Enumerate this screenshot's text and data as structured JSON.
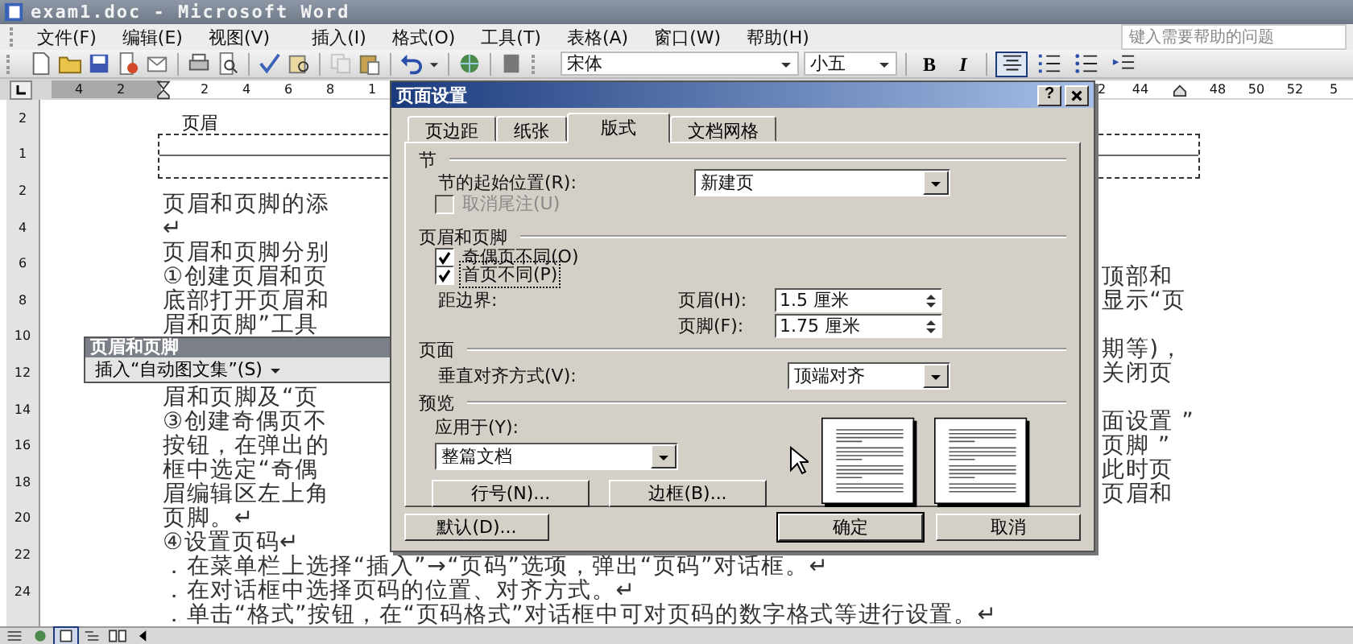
{
  "window": {
    "title": "exam1.doc - Microsoft Word"
  },
  "menu": [
    "文件(F)",
    "编辑(E)",
    "视图(V)",
    "插入(I)",
    "格式(O)",
    "工具(T)",
    "表格(A)",
    "窗口(W)",
    "帮助(H)"
  ],
  "help_box": {
    "placeholder": "键入需要帮助的问题"
  },
  "toolbar": {
    "font": "宋体",
    "size": "小五",
    "format_buttons": [
      {
        "label": "B",
        "kind": "bold",
        "selected": false
      },
      {
        "label": "I",
        "kind": "italic",
        "selected": false
      }
    ],
    "paragraph_buttons": [
      {
        "kind": "center",
        "selected": true
      },
      {
        "kind": "numbered",
        "selected": false
      },
      {
        "kind": "bullets",
        "selected": false
      },
      {
        "kind": "indent",
        "selected": false
      }
    ]
  },
  "ruler": {
    "left_labels": [
      "4",
      "2",
      "2",
      "4",
      "6",
      "8",
      "1"
    ],
    "right_labels": [
      "2",
      "44",
      "48",
      "50",
      "52",
      "5"
    ]
  },
  "vertical_ruler": {
    "labels": [
      "2",
      "1",
      "2",
      "4",
      "6",
      "8",
      "10",
      "12",
      "14",
      "16",
      "18",
      "20",
      "22",
      "24"
    ]
  },
  "document": {
    "header_label": "页眉",
    "lines": [
      {
        "left": "页眉和页脚的添"
      },
      {
        "left": "↵"
      },
      {
        "left": "页眉和页脚分别"
      },
      {
        "left": "①创建页眉和页",
        "right": "顶部和"
      },
      {
        "left": "底部打开页眉和",
        "right": "显示“页"
      },
      {
        "left": "眉和页脚”工具"
      },
      {
        "right": "期等)，"
      },
      {
        "right": "关闭页"
      },
      {
        "left": "眉和页脚及“页"
      },
      {
        "left": "③创建奇偶页不",
        "right": "面设置 ”"
      },
      {
        "left": "按钮，在弹出的",
        "right": "页脚 ”"
      },
      {
        "left": "框中选定“奇偶",
        "right": "此时页"
      },
      {
        "left": "眉编辑区左上角",
        "right": "页眉和"
      },
      {
        "left": "页脚。↵"
      },
      {
        "left": "④设置页码↵"
      },
      {
        "left": "．在菜单栏上选择“插入”→“页码”选项，弹出“页码”对话框。↵"
      },
      {
        "left": "．在对话框中选择页码的位置、对齐方式。↵"
      },
      {
        "left": "．单击“格式”按钮，在“页码格式”对话框中可对页码的数字格式等进行设置。↵"
      }
    ]
  },
  "floating_toolbar": {
    "title": "页眉和页脚",
    "button": "插入“自动图文集”(S)"
  },
  "dialog": {
    "title": "页面设置",
    "help_button": "?",
    "tabs": [
      {
        "label": "页边距",
        "selected": false
      },
      {
        "label": "纸张",
        "selected": false
      },
      {
        "label": "版式",
        "selected": true
      },
      {
        "label": "文档网格",
        "selected": false
      }
    ],
    "section": {
      "heading": "节",
      "start_label": "节的起始位置(R):",
      "start_value": "新建页",
      "endnote": {
        "label": "取消尾注(U)",
        "checked": false,
        "disabled": true
      }
    },
    "headers_footers": {
      "heading": "页眉和页脚",
      "options": [
        {
          "label": "奇偶页不同(O)",
          "checked": true,
          "focused": false
        },
        {
          "label": "首页不同(P)",
          "checked": true,
          "focused": true
        }
      ],
      "distance_label": "距边界:",
      "header_label": "页眉(H):",
      "header_value": "1.5 厘米",
      "footer_label": "页脚(F):",
      "footer_value": "1.75 厘米"
    },
    "page": {
      "heading": "页面",
      "valign_label": "垂直对齐方式(V):",
      "valign_value": "顶端对齐"
    },
    "preview": {
      "heading": "预览",
      "apply_label": "应用于(Y):",
      "apply_value": "整篇文档"
    },
    "panel_buttons": [
      "行号(N)...",
      "边框(B)..."
    ],
    "footer_buttons": [
      {
        "label": "默认(D)...",
        "kind": "extra"
      },
      {
        "label": "确定",
        "kind": "default"
      },
      {
        "label": "取消",
        "kind": "normal"
      }
    ]
  }
}
